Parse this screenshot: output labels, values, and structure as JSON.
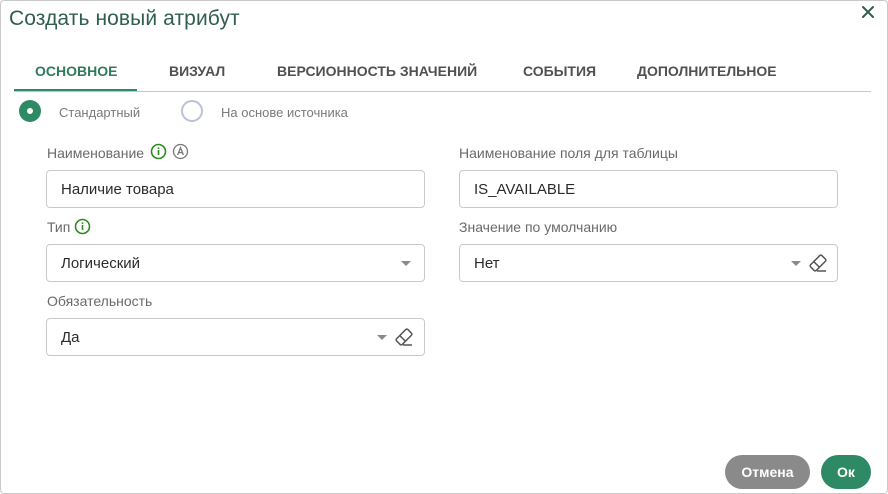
{
  "dialog": {
    "title": "Создать новый атрибут"
  },
  "tabs": [
    {
      "label": "ОСНОВНОЕ",
      "active": true
    },
    {
      "label": "ВИЗУАЛ",
      "active": false
    },
    {
      "label": "ВЕРСИОННОСТЬ ЗНАЧЕНИЙ",
      "active": false
    },
    {
      "label": "СОБЫТИЯ",
      "active": false
    },
    {
      "label": "ДОПОЛНИТЕЛЬНОЕ",
      "active": false
    }
  ],
  "source_mode": {
    "options": [
      {
        "label": "Стандартный",
        "selected": true
      },
      {
        "label": "На основе источника",
        "selected": false
      }
    ]
  },
  "fields": {
    "name": {
      "label": "Наименование",
      "value": "Наличие товара",
      "icons": [
        "info-icon",
        "auto-translate-icon"
      ]
    },
    "table_field": {
      "label": "Наименование поля для таблицы",
      "value": "IS_AVAILABLE"
    },
    "type": {
      "label": "Тип",
      "value": "Логический",
      "icons": [
        "info-icon"
      ]
    },
    "default_value": {
      "label": "Значение по умолчанию",
      "value": "Нет"
    },
    "required": {
      "label": "Обязательность",
      "value": "Да"
    }
  },
  "footer": {
    "cancel_label": "Отмена",
    "ok_label": "Ок"
  },
  "colors": {
    "accent": "#2e8a65",
    "title": "#2f5f4c",
    "cancel": "#8a8a8a"
  }
}
